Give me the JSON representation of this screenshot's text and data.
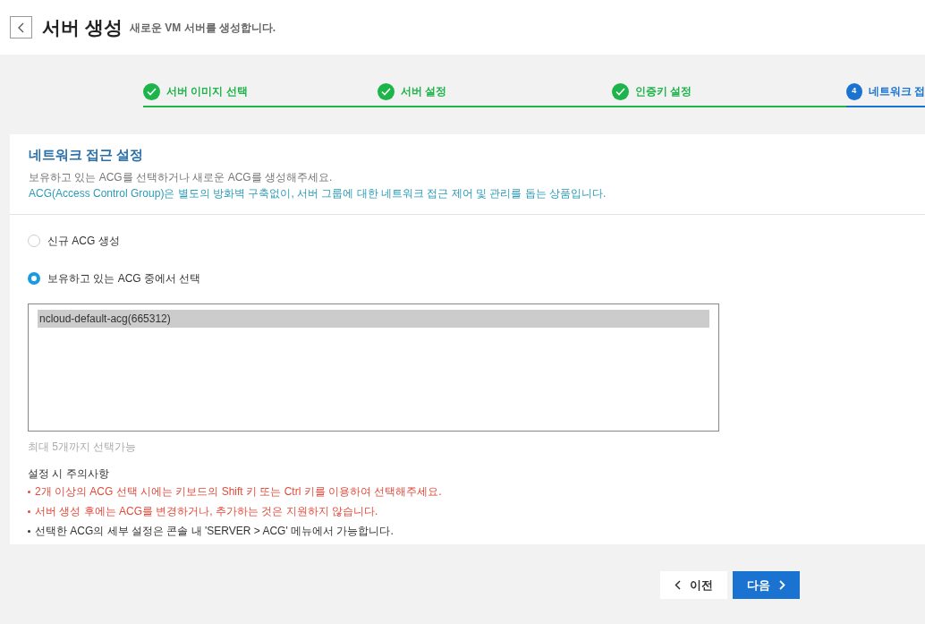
{
  "header": {
    "title": "서버 생성",
    "subtitle": "새로운 VM 서버를 생성합니다."
  },
  "steps": [
    {
      "label": "서버 이미지 선택",
      "done": true,
      "selected": false
    },
    {
      "label": "서버 설정",
      "done": true,
      "selected": false
    },
    {
      "label": "인증키 설정",
      "done": true,
      "selected": false
    },
    {
      "label": "네트워크 접",
      "number": "4",
      "done": false,
      "selected": true
    }
  ],
  "section": {
    "title": "네트워크 접근 설정",
    "description": "보유하고 있는 ACG를 선택하거나 새로운 ACG를 생성해주세요.",
    "info": "ACG(Access Control Group)은 별도의 방화벽 구축없이, 서버 그룹에 대한 네트워크 접근 제어 및 관리를 돕는 상품입니다."
  },
  "options": [
    {
      "label": "신규 ACG 생성",
      "selected": false
    },
    {
      "label": "보유하고 있는 ACG 중에서 선택",
      "selected": true
    }
  ],
  "acg_list": [
    {
      "label": "ncloud-default-acg(665312)",
      "selected": true
    }
  ],
  "hint": "최대 5개까지 선택가능",
  "notes": {
    "title": "설정 시 주의사항",
    "items": [
      {
        "text": "2개 이상의 ACG 선택 시에는 키보드의 Shift 키 또는 Ctrl 키를 이용하여 선택해주세요.",
        "kind": "warning"
      },
      {
        "text": "서버 생성 후에는 ACG를 변경하거나, 추가하는 것은 지원하지 않습니다.",
        "kind": "warning"
      },
      {
        "text": "선택한 ACG의 세부 설정은 콘솔 내 'SERVER > ACG' 메뉴에서 가능합니다.",
        "kind": "normal"
      }
    ]
  },
  "buttons": {
    "prev": "이전",
    "next": "다음"
  }
}
